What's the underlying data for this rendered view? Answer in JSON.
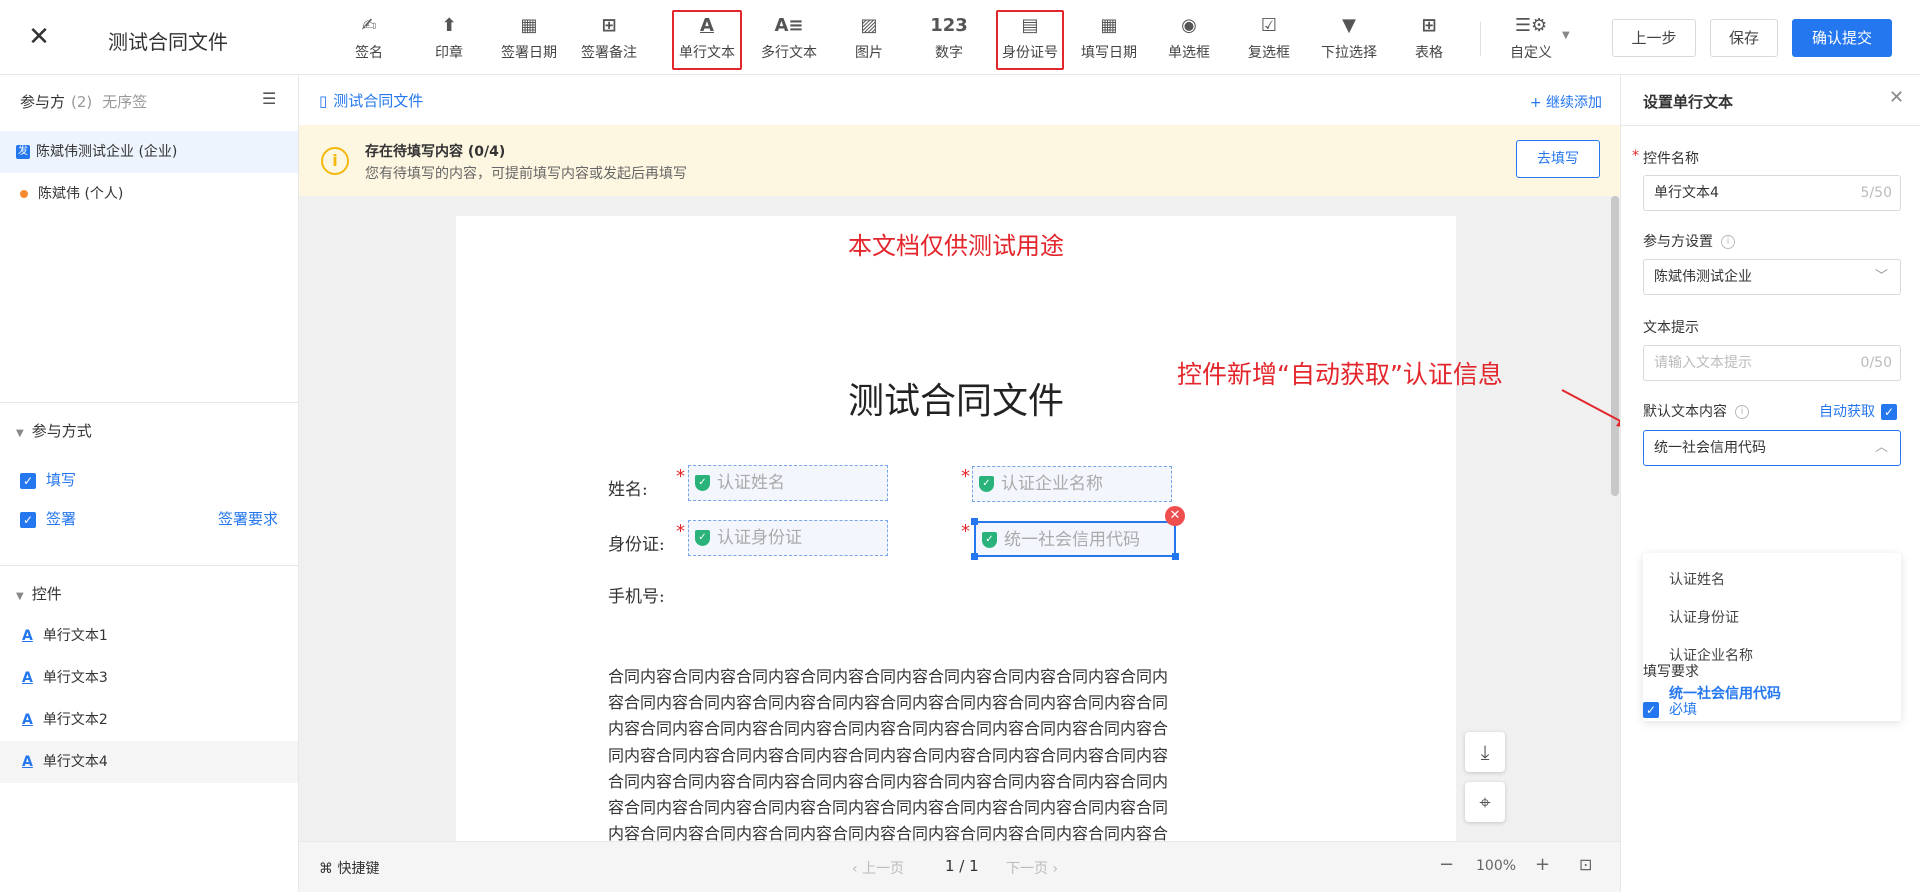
{
  "header": {
    "close_icon": "close-icon",
    "title": "测试合同文件",
    "tools": [
      {
        "label": "签名",
        "icon": "✍"
      },
      {
        "label": "印章",
        "icon": "⬆"
      },
      {
        "label": "签署日期",
        "icon": "▦"
      },
      {
        "label": "签署备注",
        "icon": "⊞"
      },
      {
        "label": "单行文本",
        "icon": "A"
      },
      {
        "label": "多行文本",
        "icon": "A≡"
      },
      {
        "label": "图片",
        "icon": "▨"
      },
      {
        "label": "数字",
        "icon": "123"
      },
      {
        "label": "身份证号",
        "icon": "▤"
      },
      {
        "label": "填写日期",
        "icon": "▦"
      },
      {
        "label": "单选框",
        "icon": "◉"
      },
      {
        "label": "复选框",
        "icon": "☑"
      },
      {
        "label": "下拉选择",
        "icon": "▼"
      },
      {
        "label": "表格",
        "icon": "⊞"
      },
      {
        "label": "自定义",
        "icon": "☰⚙"
      }
    ],
    "prev_label": "上一步",
    "save_label": "保存",
    "submit_label": "确认提交",
    "highlight_color": "#e3262c",
    "accent_color": "#2477ef"
  },
  "left": {
    "participants_label": "参与方",
    "participants_count": "(2)",
    "order_label": "无序签",
    "parties": [
      {
        "badge": "发",
        "name": "陈斌伟测试企业 (企业)"
      },
      {
        "name": "陈斌伟 (个人)"
      }
    ],
    "mode_section": "参与方式",
    "mode_options": [
      "填写",
      "签署"
    ],
    "sign_requirement_link": "签署要求",
    "controls_section": "控件",
    "controls": [
      "单行文本1",
      "单行文本3",
      "单行文本2",
      "单行文本4"
    ]
  },
  "main": {
    "file_name": "测试合同文件",
    "add_more": "+ 继续添加",
    "notice_title": "存在待填写内容 (0/4)",
    "notice_sub": "您有待填写的内容，可提前填写内容或发起后再填写",
    "goto_fill": "去填写",
    "doc": {
      "watermark": "本文档仅供测试用途",
      "title": "测试合同文件",
      "name_label": "姓名:",
      "id_label": "身份证:",
      "phone_label": "手机号:",
      "fields": [
        "认证姓名",
        "认证企业名称",
        "认证身份证",
        "统一社会信用代码"
      ],
      "body": "合同内容合同内容合同内容合同内容合同内容合同内容合同内容合同内容合同内容合同内容合同内容合同内容合同内容合同内容合同内容合同内容合同内容合同内容合同内容合同内容合同内容合同内容合同内容合同内容合同内容合同内容合同内容合同内容合同内容合同内容合同内容合同内容合同内容合同内容合同内容合同内容合同内容合同内容合同内容合同内容合同内容合同内容合同内容合同内容合同内容合同内容合同内容合同内容合同内容合同内容合同内容合同内容合同内容合同内容合同内容合同内容合同内容合同内容合同内容合同内容合同内容合同内容合同内容合同内容合同内容合同内容合同内容合同内容合同内容合同内容合同内容合同内容合同内容"
    },
    "shortcut": "快捷键",
    "prev_page": "‹ 上一页",
    "page_indicator": "1 / 1",
    "next_page": "下一页 ›",
    "zoom": "100%"
  },
  "annotation": "控件新增“自动获取”认证信息",
  "right": {
    "title": "设置单行文本",
    "control_name_label": "控件名称",
    "control_name_value": "单行文本4",
    "control_name_counter": "5/50",
    "party_setting_label": "参与方设置",
    "party_setting_value": "陈斌伟测试企业",
    "text_hint_label": "文本提示",
    "text_hint_placeholder": "请输入文本提示",
    "text_hint_counter": "0/50",
    "default_text_label": "默认文本内容",
    "auto_fetch_label": "自动获取",
    "default_text_value": "统一社会信用代码",
    "dropdown_options": [
      "认证姓名",
      "认证身份证",
      "认证企业名称",
      "统一社会信用代码"
    ],
    "selected_option": "统一社会信用代码",
    "fill_requirement_label": "填写要求",
    "required_label": "必填"
  }
}
